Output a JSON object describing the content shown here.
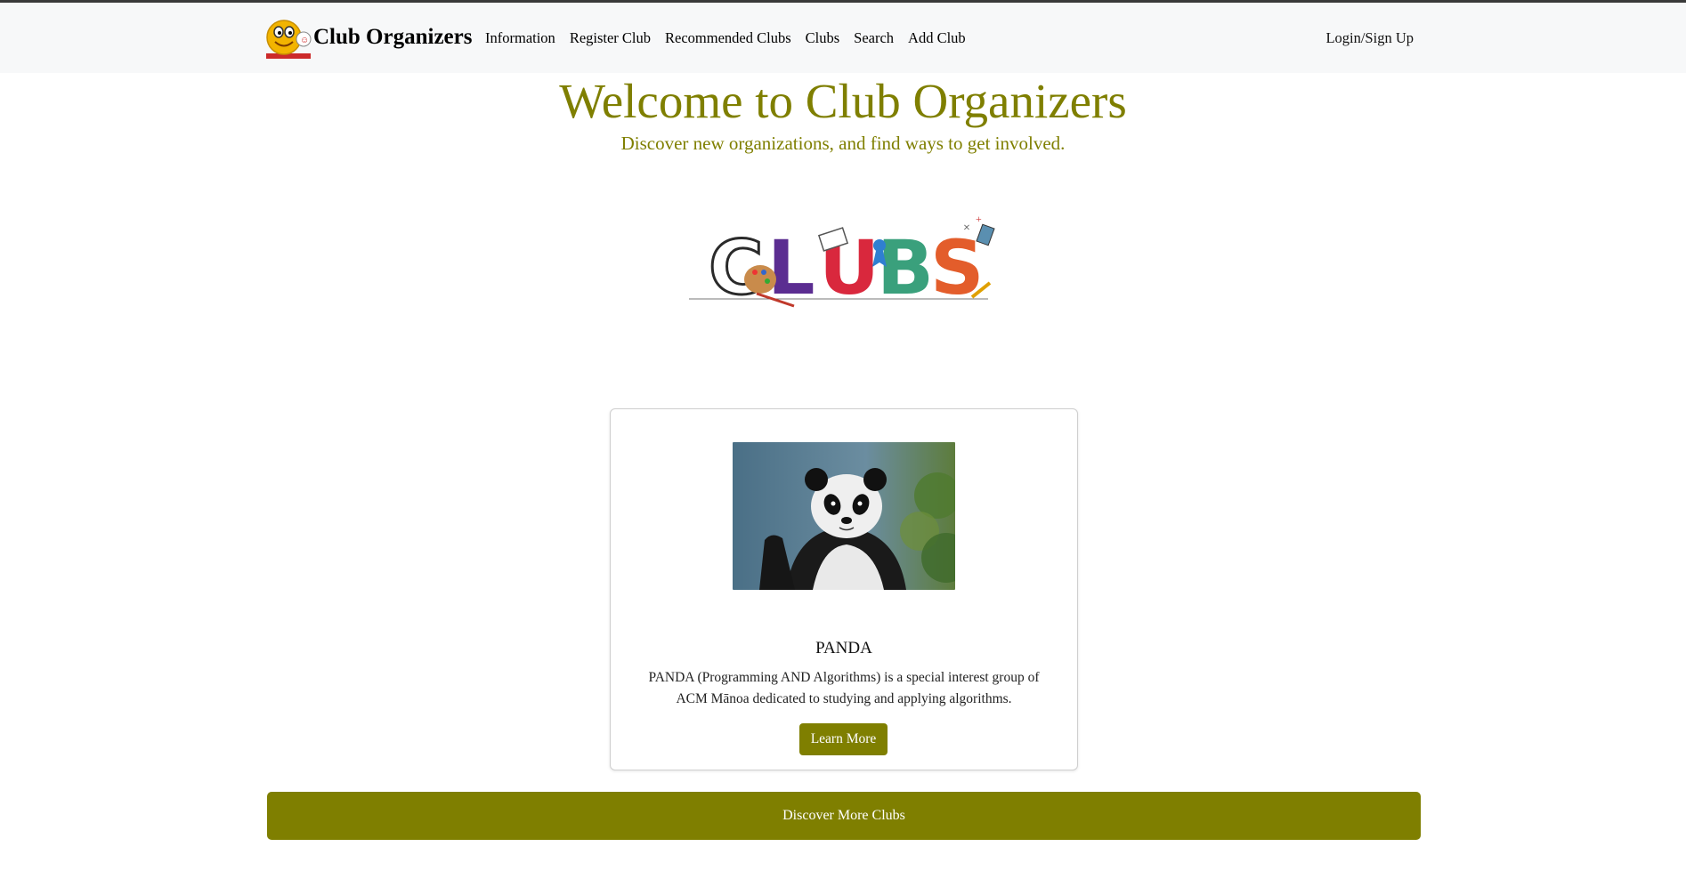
{
  "navbar": {
    "brand": "Club Organizers",
    "links": [
      "Information",
      "Register Club",
      "Recommended Clubs",
      "Clubs",
      "Search",
      "Add Club"
    ],
    "login": "Login/Sign Up"
  },
  "hero": {
    "title": "Welcome to Club Organizers",
    "subtitle": "Discover new organizations, and find ways to get involved."
  },
  "logo_image": {
    "text": "CLUBS"
  },
  "card": {
    "title": "PANDA",
    "description": "PANDA (Programming AND Algorithms) is a special interest group of ACM Mānoa dedicated to studying and applying algorithms.",
    "button": "Learn More"
  },
  "discover_button": "Discover More Clubs",
  "colors": {
    "accent": "#7f7f00",
    "navbar_bg": "#f7f8f9"
  }
}
